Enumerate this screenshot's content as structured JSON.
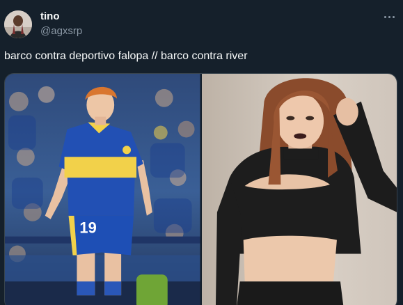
{
  "tweet": {
    "author": {
      "display_name": "tino",
      "handle": "@agxsrp",
      "avatar_icon": "avatar-photo"
    },
    "more_icon": "more-horizontal-icon",
    "text": "barco contra deportivo falopa // barco contra river",
    "media": [
      {
        "kind": "photo",
        "icon": "photo-football-player",
        "jersey_number": "19"
      },
      {
        "kind": "photo",
        "icon": "photo-portrait-woman"
      }
    ]
  },
  "colors": {
    "background": "#15202b",
    "text_primary": "#f7f9f9",
    "text_secondary": "#8b98a5",
    "border": "#38444d"
  }
}
